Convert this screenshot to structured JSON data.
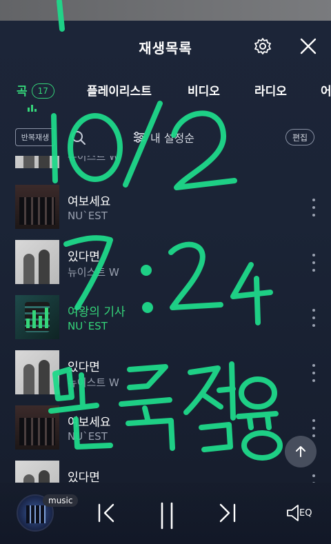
{
  "header": {
    "title": "재생목록",
    "settings_icon": "gear-icon",
    "close_icon": "close-icon"
  },
  "tabs": [
    {
      "label": "곡",
      "count": "17",
      "active": true
    },
    {
      "label": "플레이리스트",
      "active": false
    },
    {
      "label": "비디오",
      "active": false
    },
    {
      "label": "라디오",
      "active": false
    },
    {
      "label": "어",
      "active": false
    }
  ],
  "toolbar": {
    "repeat_label": "반복재생",
    "sort_label": "내 설정순",
    "edit_label": "편집"
  },
  "partial_row": {
    "artist": "뉴이스트 W"
  },
  "songs": [
    {
      "title": "여보세요",
      "artist": "NU`EST",
      "art": "dark",
      "playing": false
    },
    {
      "title": "있다면",
      "artist": "뉴이스트 W",
      "art": "gray",
      "playing": false
    },
    {
      "title": "여왕의 기사",
      "artist": "NU`EST",
      "art": "teal",
      "playing": true
    },
    {
      "title": "있다면",
      "artist": "뉴이스트 W",
      "art": "gray",
      "playing": false
    },
    {
      "title": "여보세요",
      "artist": "NU`EST",
      "art": "dark",
      "playing": false
    },
    {
      "title": "있다면",
      "artist": "",
      "art": "gray",
      "playing": false
    }
  ],
  "player": {
    "source_label": "music",
    "eq_label": "EQ"
  },
  "colors": {
    "accent": "#35d67a",
    "background": "#1b2436",
    "handwriting": "#1fd98a"
  },
  "handwriting": {
    "line1": "10/2",
    "line2": "7:24",
    "line3": "팬톡전용"
  }
}
